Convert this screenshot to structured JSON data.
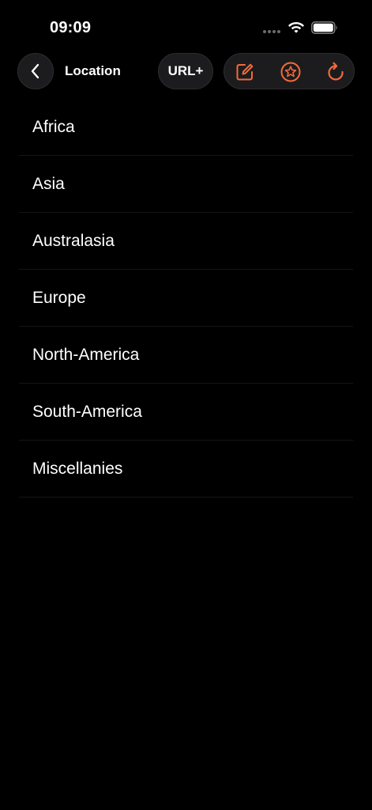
{
  "status_bar": {
    "time": "09:09"
  },
  "nav": {
    "title": "Location",
    "url_button_label": "URL+",
    "accent_color": "#F26B3A",
    "icons": {
      "back": "chevron-left-icon",
      "edit": "square-pencil-icon",
      "favorite": "star-circle-icon",
      "refresh": "refresh-arrow-icon"
    }
  },
  "locations": [
    {
      "label": "Africa"
    },
    {
      "label": "Asia"
    },
    {
      "label": "Australasia"
    },
    {
      "label": "Europe"
    },
    {
      "label": "North-America"
    },
    {
      "label": "South-America"
    },
    {
      "label": "Miscellanies"
    }
  ]
}
